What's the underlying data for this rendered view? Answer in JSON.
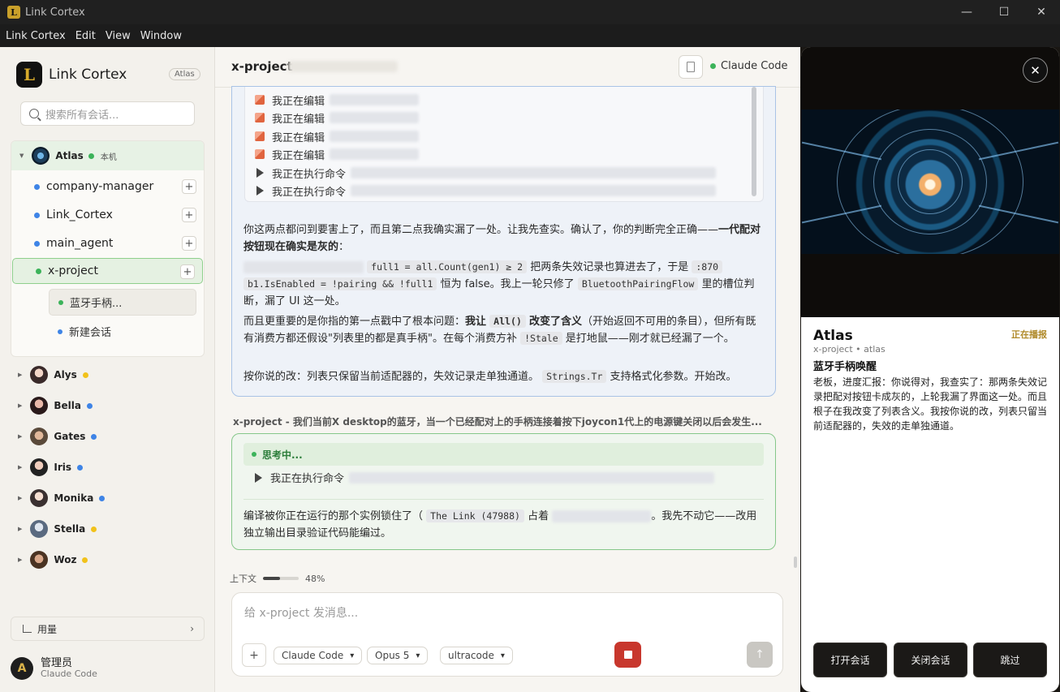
{
  "window": {
    "title": "Link Cortex",
    "app_icon_letter": "L",
    "controls": {
      "minimize": "—",
      "maximize": "☐",
      "close": "✕"
    }
  },
  "menu": [
    "Link Cortex",
    "Edit",
    "View",
    "Window"
  ],
  "sidebar": {
    "brand": {
      "logo_letter": "L",
      "name": "Link Cortex",
      "badge": "Atlas"
    },
    "search_placeholder": "搜索所有会话...",
    "atlas": {
      "name": "Atlas",
      "status_color": "#3cb35a",
      "local_tag": "本机",
      "projects": [
        {
          "name": "company-manager",
          "status_color": "#3e84e6"
        },
        {
          "name": "Link_Cortex",
          "status_color": "#3e84e6"
        },
        {
          "name": "main_agent",
          "status_color": "#3e84e6"
        },
        {
          "name": "x-project",
          "status_color": "#3cb35a",
          "active": true
        }
      ],
      "sessions": [
        {
          "name": "蓝牙手柄...",
          "status_color": "#3cb35a",
          "active": true
        },
        {
          "name": "新建会话",
          "status_color": "#3e84e6"
        }
      ],
      "add_label": "+"
    },
    "agents": [
      {
        "name": "Alys",
        "status_color": "#f1c21b"
      },
      {
        "name": "Bella",
        "status_color": "#3e84e6"
      },
      {
        "name": "Gates",
        "status_color": "#3e84e6"
      },
      {
        "name": "Iris",
        "status_color": "#3e84e6"
      },
      {
        "name": "Monika",
        "status_color": "#3e84e6"
      },
      {
        "name": "Stella",
        "status_color": "#f1c21b"
      },
      {
        "name": "Woz",
        "status_color": "#f1c21b"
      }
    ],
    "usage_label": "用量",
    "user": {
      "avatar_letter": "A",
      "name": "管理员",
      "role": "Claude Code"
    }
  },
  "main": {
    "title": "x-project",
    "engine": "Claude Code",
    "engine_status_color": "#3cb35a",
    "tool_calls": [
      {
        "type": "edit",
        "label": "我正在编辑"
      },
      {
        "type": "edit",
        "label": "我正在编辑"
      },
      {
        "type": "edit",
        "label": "我正在编辑"
      },
      {
        "type": "edit",
        "label": "我正在编辑"
      },
      {
        "type": "run",
        "label": "我正在执行命令"
      },
      {
        "type": "run",
        "label": "我正在执行命令"
      }
    ],
    "message": {
      "p1_a": "你这两点都问到要害上了，而且第二点我确实漏了一处。让我先查实。确认了，你的判断完全正确——",
      "p1_b": "一代配对按钮现在确实是灰的",
      "p1_c": "：",
      "code_full1": "full1 = all.Count(gen1) ≥ 2",
      "p2_a": "把两条失效记录也算进去了，于是",
      "code_line": ":870",
      "code_enabled": "b1.IsEnabled = !pairing && !full1",
      "p2_b": "恒为 false。我上一轮只修了",
      "code_flow": "BluetoothPairingFlow",
      "p2_c": "里的槽位判断，漏了 UI 这一处。",
      "p3_a": "而且更重要的是你指的第一点戳中了根本问题：",
      "p3_b": "我让",
      "code_all": "All()",
      "p3_c": "改变了含义",
      "p3_d": "（开始返回不可用的条目），但所有既有消费方都还假设\"列表里的都是真手柄\"。在每个消费方补",
      "code_stale": "!Stale",
      "p3_e": "是打地鼠——刚才就已经漏了一个。",
      "p4_a": "按你说的改：列表只保留当前适配器的，失效记录走单独通道。",
      "code_strings": "Strings.Tr",
      "p4_b": "支持格式化参数。开始改。"
    },
    "session_preview": "x-project - 我们当前X desktop的蓝牙，当一个已经配对上的手柄连接着按下joycon1代上的电源键关闭以后会发生...",
    "thinking": {
      "label": "思考中...",
      "tool": "我正在执行命令",
      "text_a": "编译被你正在运行的那个实例锁住了（",
      "code_link": "The Link (47988)",
      "text_b": "占着",
      "text_c": "。我先不动它——改用独立输出目录验证代码能编过。"
    },
    "context": {
      "label": "上下文",
      "percent_text": "48%",
      "fraction": 0.48
    },
    "composer": {
      "placeholder": "给 x-project 发消息...",
      "plus": "+",
      "engine_select": "Claude Code",
      "model_select": "Opus 5",
      "mode_select": "ultracode",
      "send": "↑"
    }
  },
  "panel": {
    "close": "✕",
    "title": "Atlas",
    "status": "正在播报",
    "subtitle": "x-project • atlas",
    "topic": "蓝牙手柄唤醒",
    "body": "老板，进度汇报：你说得对，我查实了：那两条失效记录把配对按钮卡成灰的，上轮我漏了界面这一处。而且根子在我改变了列表含义。我按你说的改，列表只留当前适配器的，失效的走单独通道。",
    "buttons": [
      "打开会话",
      "关闭会话",
      "跳过"
    ]
  }
}
